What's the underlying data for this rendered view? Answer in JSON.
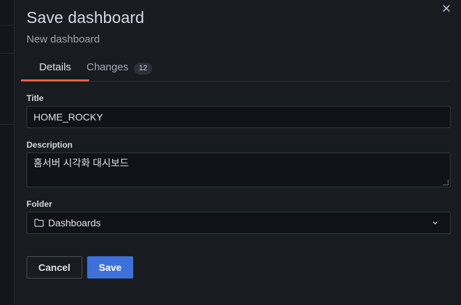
{
  "dialog": {
    "title": "Save dashboard",
    "subtitle": "New dashboard",
    "close_icon": "close-icon"
  },
  "tabs": [
    {
      "label": "Details",
      "active": true
    },
    {
      "label": "Changes",
      "count": "12",
      "active": false
    }
  ],
  "form": {
    "title_label": "Title",
    "title_value": "HOME_ROCKY",
    "description_label": "Description",
    "description_value": "홈서버 시각화 대시보드",
    "folder_label": "Folder",
    "folder_value": "Dashboards",
    "folder_icon": "folder-icon",
    "dropdown_icon": "chevron-down-icon"
  },
  "buttons": {
    "cancel": "Cancel",
    "save": "Save"
  },
  "colors": {
    "tab_underline": "#f55f3e",
    "primary_button": "#3d71d9"
  }
}
